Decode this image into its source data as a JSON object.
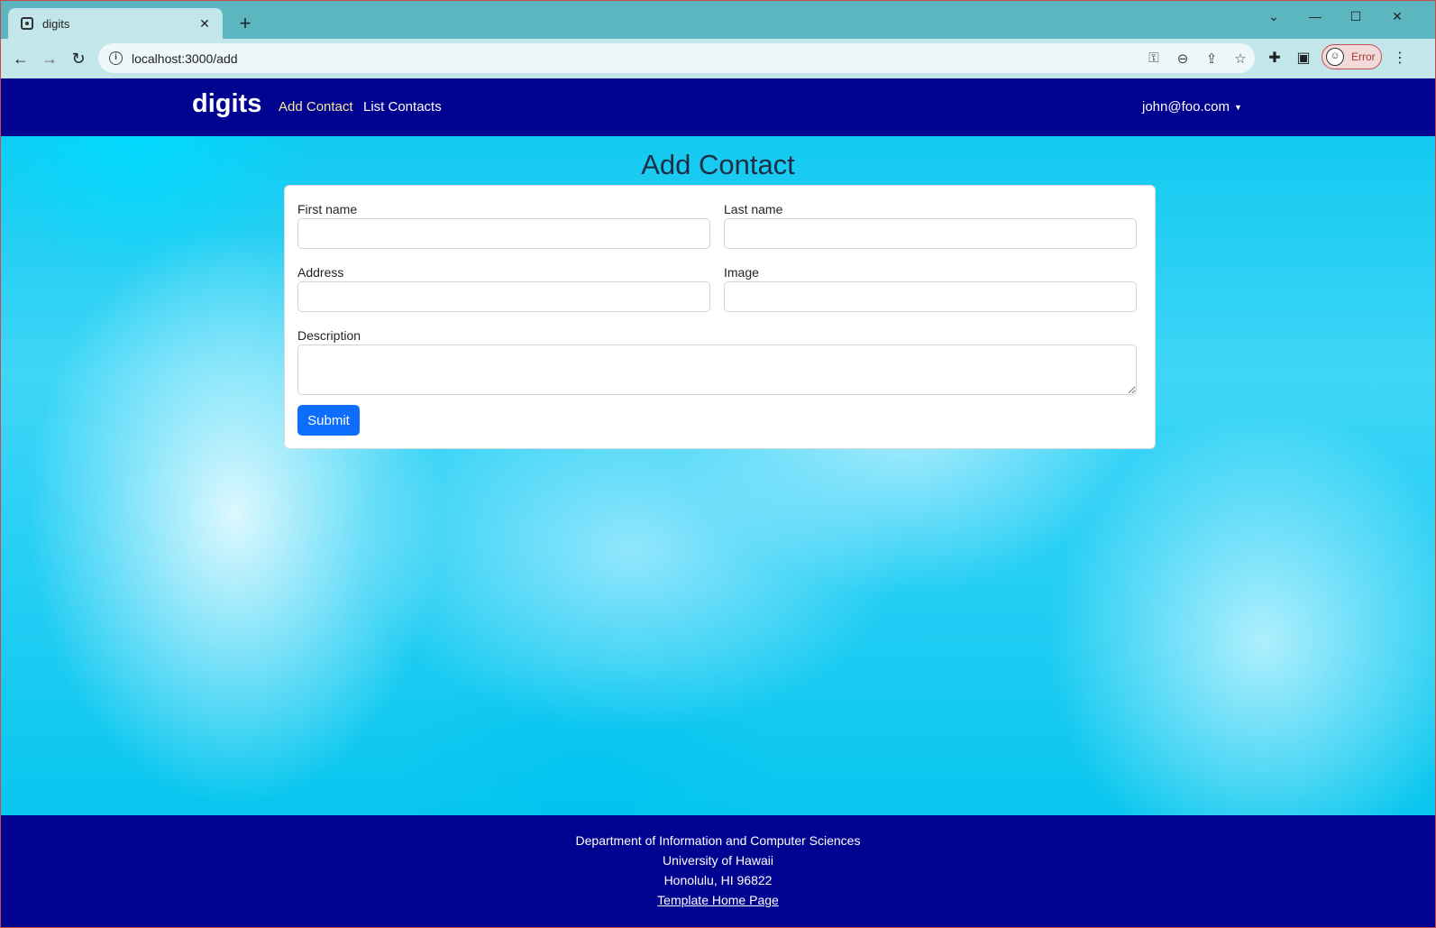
{
  "browser": {
    "tab": {
      "title": "digits",
      "close_label": "✕"
    },
    "new_tab_label": "+",
    "url": "localhost:3000/add",
    "profile": {
      "status": "Error"
    }
  },
  "navbar": {
    "brand": "digits",
    "links": [
      {
        "label": "Add Contact",
        "active": true
      },
      {
        "label": "List Contacts",
        "active": false
      }
    ],
    "user": "john@foo.com"
  },
  "form": {
    "title": "Add Contact",
    "fields": {
      "first_name": {
        "label": "First name",
        "value": ""
      },
      "last_name": {
        "label": "Last name",
        "value": ""
      },
      "address": {
        "label": "Address",
        "value": ""
      },
      "image": {
        "label": "Image",
        "value": ""
      },
      "description": {
        "label": "Description",
        "value": ""
      }
    },
    "submit_label": "Submit"
  },
  "footer": {
    "lines": [
      "Department of Information and Computer Sciences",
      "University of Hawaii",
      "Honolulu, HI 96822"
    ],
    "link_label": "Template Home Page"
  },
  "colors": {
    "navbar_bg": "#000290",
    "active_link": "#f8e9a1",
    "submit_button": "#0d6efd",
    "tab_strip": "#5cb6c0"
  },
  "icons": {
    "back": "arrow-left-icon",
    "forward": "arrow-right-icon",
    "reload": "reload-icon",
    "site_info": "info-icon",
    "password": "key-icon",
    "zoom": "zoom-icon",
    "share": "share-icon",
    "bookmark": "star-icon",
    "extensions": "puzzle-icon",
    "side_panel": "side-panel-icon",
    "menu": "kebab-menu-icon"
  }
}
